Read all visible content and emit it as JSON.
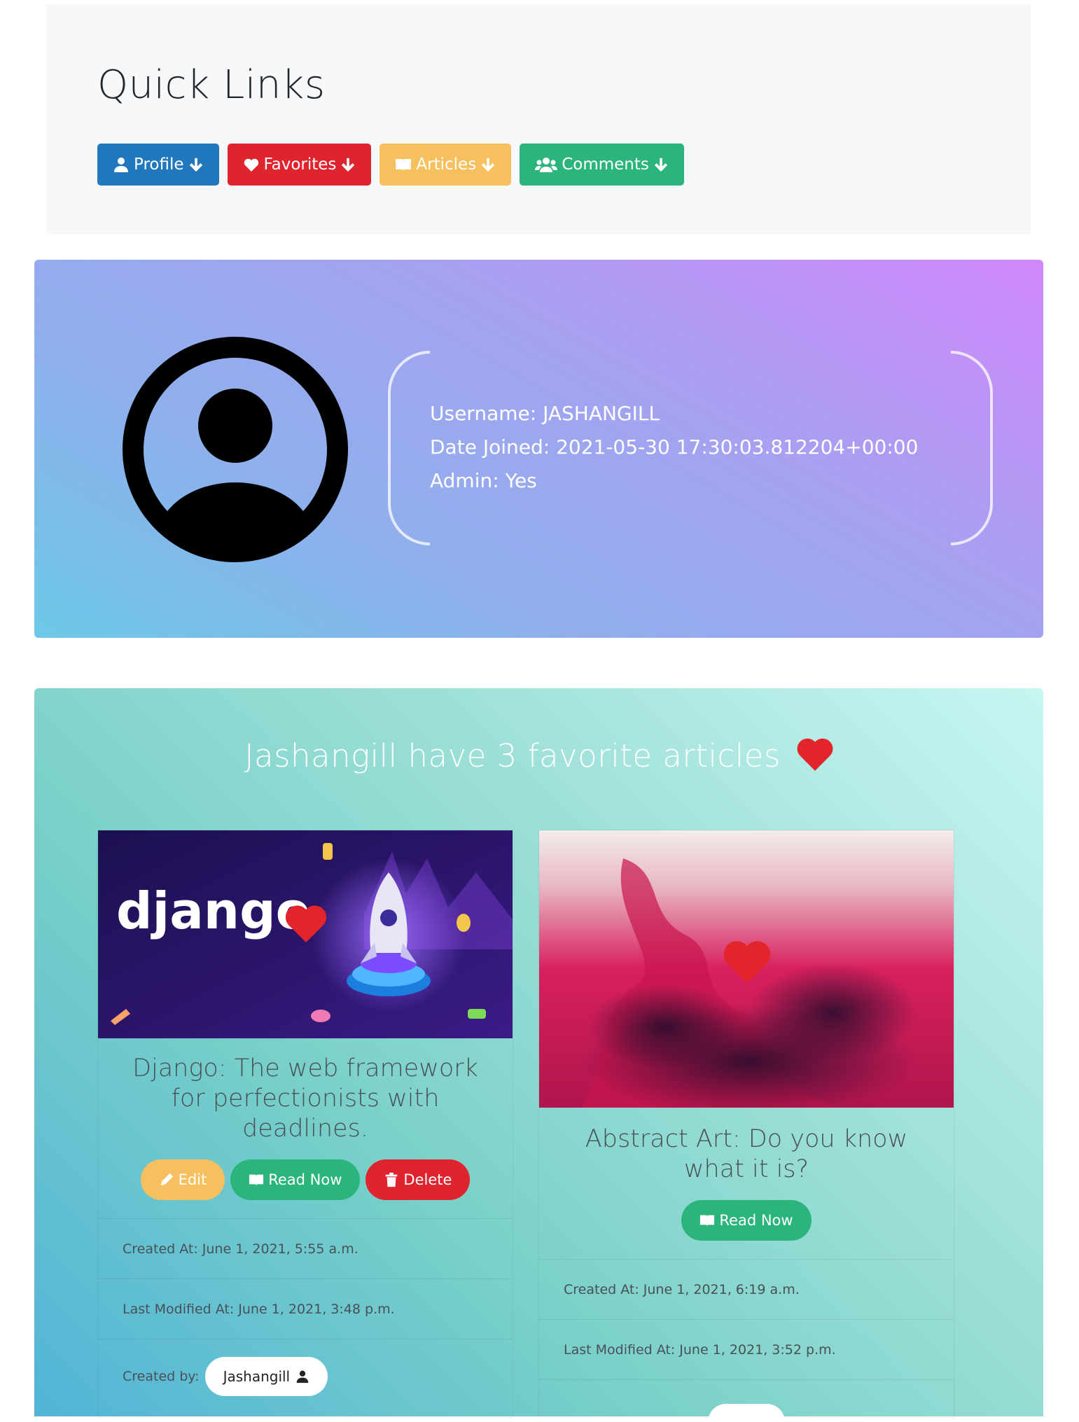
{
  "quick_links": {
    "title": "Quick Links",
    "buttons": [
      {
        "label": "Profile",
        "color": "#2178bd"
      },
      {
        "label": "Favorites",
        "color": "#e0242e"
      },
      {
        "label": "Articles",
        "color": "#f6c05f"
      },
      {
        "label": "Comments",
        "color": "#2bb57d"
      }
    ]
  },
  "profile": {
    "username": "Username: JASHANGILL",
    "date_joined": "Date Joined: 2021-05-30 17:30:03.812204+00:00",
    "admin": "Admin: Yes"
  },
  "favorites": {
    "title": "Jashangill have 3 favorite articles",
    "heart_color": "#e3242b",
    "articles": [
      {
        "image_text": "django",
        "title": "Django: The web framework for perfectionists with deadlines.",
        "buttons": {
          "edit": "Edit",
          "read": "Read Now",
          "delete": "Delete"
        },
        "created": "Created At: June 1, 2021, 5:55 a.m.",
        "modified": "Last Modified At: June 1, 2021, 3:48 p.m.",
        "created_by_label": "Created by:",
        "author": "Jashangill"
      },
      {
        "title": "Abstract Art: Do you know what it is?",
        "buttons": {
          "read": "Read Now"
        },
        "created": "Created At: June 1, 2021, 6:19 a.m.",
        "modified": "Last Modified At: June 1, 2021, 3:52 p.m."
      }
    ]
  },
  "colors": {
    "edit": "#f6c05f",
    "read": "#2bb57d",
    "delete": "#e0242e"
  }
}
